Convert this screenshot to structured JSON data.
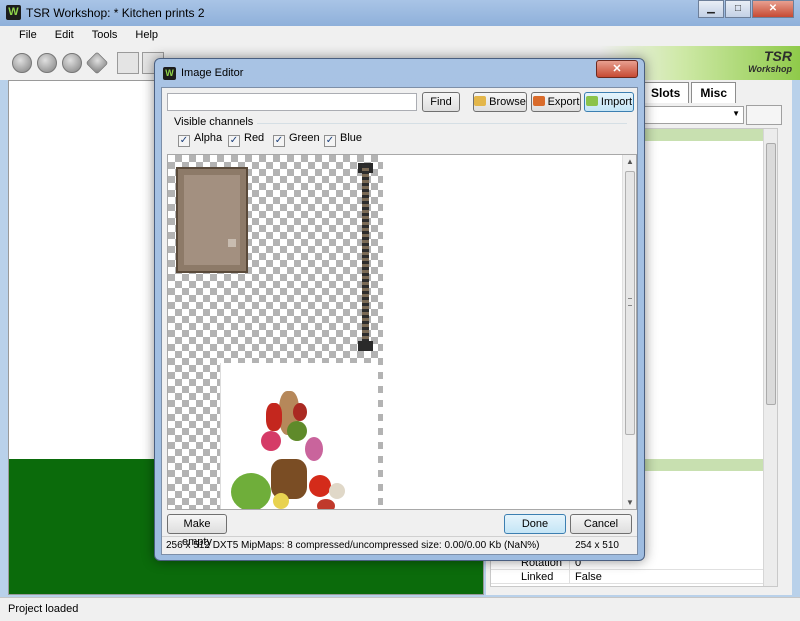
{
  "main_window": {
    "title": "TSR Workshop: * Kitchen prints 2",
    "app_icon": "W",
    "controls": {
      "minimize": "▁",
      "maximize": "□",
      "close": "✕"
    }
  },
  "menu": [
    "File",
    "Edit",
    "Tools",
    "Help"
  ],
  "toolbar": {
    "logo_line1": "TSR",
    "logo_line2": "Workshop"
  },
  "right_panel": {
    "tabs": [
      "Slots",
      "Misc"
    ],
    "properties": [
      {
        "name": "Rotation",
        "value": "0"
      },
      {
        "name": "Linked",
        "value": "False"
      }
    ]
  },
  "status_bar": {
    "text": "Project loaded"
  },
  "image_editor": {
    "title": "Image Editor",
    "icon": "W",
    "close_label": "✕",
    "search": {
      "value": ""
    },
    "find_label": "Find",
    "browse_label": "Browse",
    "export_label": "Export",
    "import_label": "Import",
    "channels_label": "Visible channels",
    "channels": [
      {
        "label": "Alpha",
        "checked": true
      },
      {
        "label": "Red",
        "checked": true
      },
      {
        "label": "Green",
        "checked": true
      },
      {
        "label": "Blue",
        "checked": true
      }
    ],
    "make_empty_label": "Make empty",
    "done_label": "Done",
    "cancel_label": "Cancel",
    "status_info": "256 x 512 DXT5 MipMaps: 8 compressed/uncompressed size: 0.00/0.00 Kb (NaN%)",
    "status_dims": "254 x 510",
    "check_mark": "✓",
    "colors": {
      "floor": "#0b6b0b",
      "title_bar": "#9ebce0",
      "accent_green": "#8fca4a"
    }
  }
}
